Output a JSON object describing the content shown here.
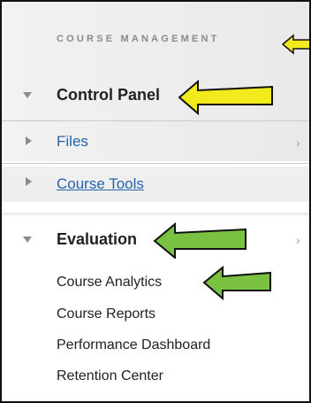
{
  "menu": {
    "section_title": "COURSE MANAGEMENT",
    "control_panel": "Control Panel",
    "files": "Files",
    "course_tools": "Course Tools",
    "evaluation": "Evaluation",
    "evaluation_items": [
      "Course Analytics",
      "Course Reports",
      "Performance Dashboard",
      "Retention Center"
    ]
  },
  "annotation_colors": {
    "yellow": "#f2ea1d",
    "green": "#7ac142"
  },
  "icons": {
    "expanded": "triangle-down-icon",
    "collapsed": "triangle-right-icon",
    "submenu": "chevron-right-icon"
  }
}
